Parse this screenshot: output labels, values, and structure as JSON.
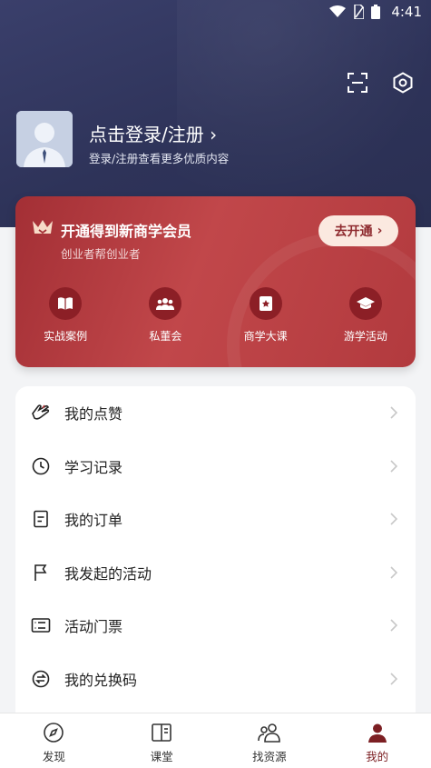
{
  "status_bar": {
    "time": "4:41"
  },
  "profile": {
    "title": "点击登录/注册",
    "chevron": "›",
    "subtitle": "登录/注册查看更多优质内容"
  },
  "vip": {
    "title": "开通得到新商学会员",
    "subtitle": "创业者帮创业者",
    "button": "去开通",
    "button_chevron": "›",
    "perks": [
      {
        "label": "实战案例",
        "icon": "book-open-icon"
      },
      {
        "label": "私董会",
        "icon": "group-icon"
      },
      {
        "label": "商学大课",
        "icon": "notebook-icon"
      },
      {
        "label": "游学活动",
        "icon": "graduation-cap-icon"
      }
    ],
    "colors": {
      "accent": "#a32f35",
      "button_bg": "#fbe9e0",
      "perk_circle": "#8c1f26"
    }
  },
  "menu": {
    "items": [
      {
        "label": "我的点赞",
        "icon": "like-hand-icon"
      },
      {
        "label": "学习记录",
        "icon": "clock-icon"
      },
      {
        "label": "我的订单",
        "icon": "order-doc-icon"
      },
      {
        "label": "我发起的活动",
        "icon": "flag-icon"
      },
      {
        "label": "活动门票",
        "icon": "ticket-icon"
      },
      {
        "label": "我的兑换码",
        "icon": "exchange-icon"
      }
    ]
  },
  "tabbar": {
    "tabs": [
      {
        "label": "发现",
        "icon": "compass-icon",
        "active": false
      },
      {
        "label": "课堂",
        "icon": "book-icon",
        "active": false
      },
      {
        "label": "找资源",
        "icon": "people-icon",
        "active": false
      },
      {
        "label": "我的",
        "icon": "user-icon",
        "active": true
      }
    ],
    "active_color": "#7c1f23"
  }
}
